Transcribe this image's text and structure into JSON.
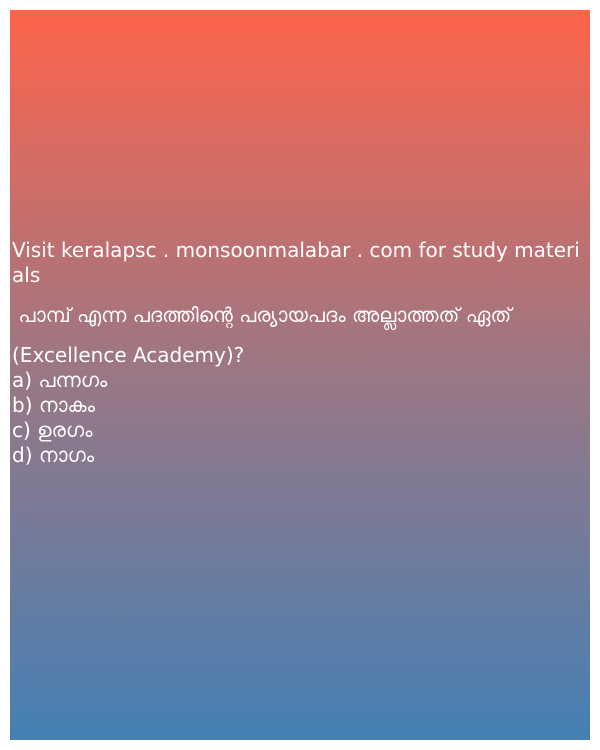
{
  "background": {
    "gradient_top": "#fe644b",
    "gradient_mid": "#9a7785",
    "gradient_bottom": "#4480b4",
    "text_color": "#ffffff"
  },
  "post": {
    "visit_text": "Visit keralapsc . monsoonmalabar . com for study materials",
    "question": " പാമ്പ് എന്ന പദത്തിന്റെ പര്യായപദം അല്ലാത്തത് ഏത്",
    "question_suffix": "(Excellence Academy)?",
    "options": [
      "a) പന്നഗം",
      "b) നാകം",
      "c) ഉരഗം",
      "d) നാഗം"
    ]
  }
}
